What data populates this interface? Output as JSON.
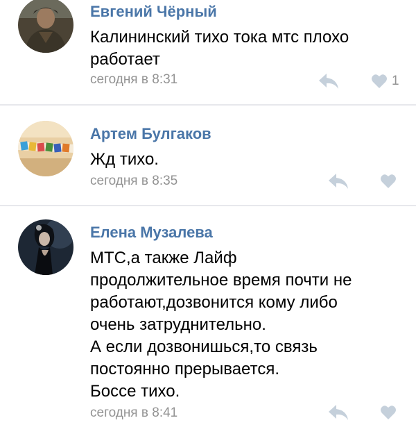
{
  "comments": [
    {
      "author": "Евгений Чёрный",
      "text_lines": [
        "Калининский тихо тока мтс плохо",
        "работает"
      ],
      "time": "сегодня в 8:31",
      "likes": "1"
    },
    {
      "author": "Артем Булгаков",
      "text_lines": [
        "Жд тихо."
      ],
      "time": "сегодня в 8:35",
      "likes": ""
    },
    {
      "author": "Елена Музалева",
      "text_lines": [
        "МТС,а также Лайф",
        "продолжительное время почти не",
        "работают,дозвонится кому либо",
        "очень затруднительно.",
        "А если дозвонишься,то связь",
        "постоянно прерывается.",
        "Боссе тихо."
      ],
      "time": "сегодня в 8:41",
      "likes": ""
    }
  ],
  "colors": {
    "link": "#4a76a8",
    "meta": "#939393",
    "icon": "#c5d0db",
    "divider": "#e7e8ec"
  },
  "icons": {
    "reply": "reply-arrow-icon",
    "like": "heart-icon"
  }
}
